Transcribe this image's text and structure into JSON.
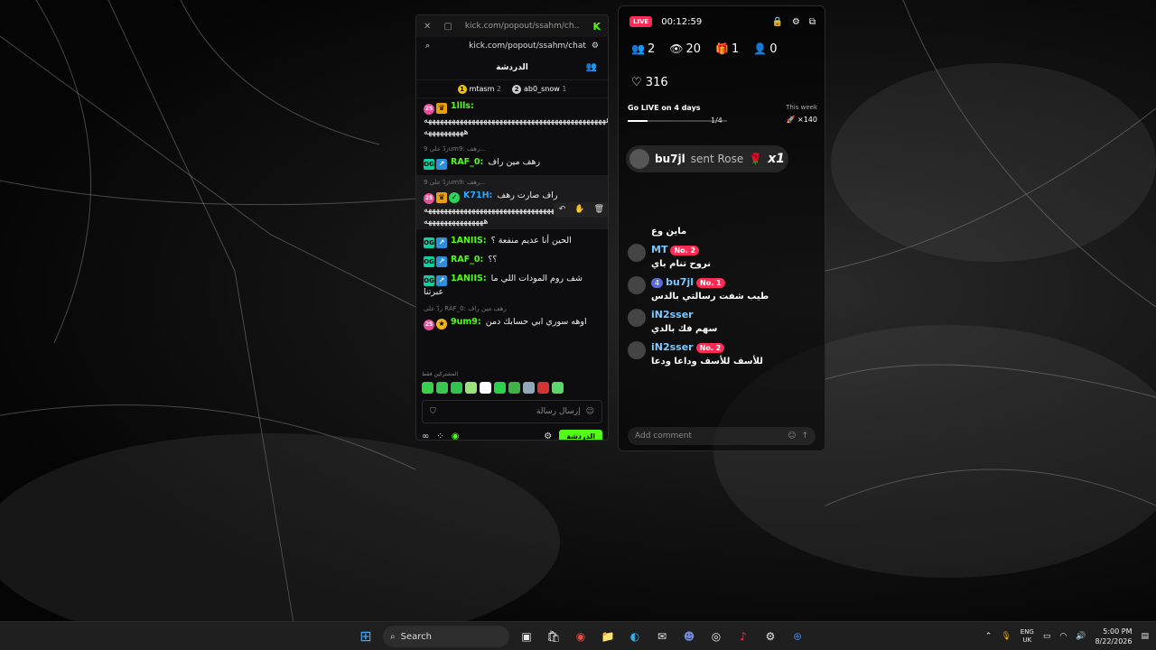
{
  "kick": {
    "window_url_title": "kick.com/popout/ssahm/ch...",
    "address": "kick.com/popout/ssahm/chat",
    "header_title": "الدردشة",
    "pinned": [
      {
        "badge": "1",
        "name": "mtasm",
        "count": "2"
      },
      {
        "badge": "2",
        "name": "ab0_snow",
        "count": "1"
      }
    ],
    "messages": [
      {
        "reply": "",
        "badges": [
          "pink-badge",
          "crown-badge"
        ],
        "user": "1llls:",
        "user_color": "#53fc18",
        "text": "ههههههههههههههههههههههههههههههههههههههههههههههه ههههههههههه"
      },
      {
        "reply": "ردّ على 9um9: رهف...",
        "badges": [
          "og-badge",
          "vip-badge"
        ],
        "user": "RAF_0:",
        "user_color": "#53fc18",
        "text": "رهف مين راف"
      },
      {
        "reply": "ردّ على 9um9: رهف...",
        "badges": [
          "pink-badge",
          "crown-badge",
          "verified-badge"
        ],
        "user": "K71H:",
        "user_color": "#2ea8ff",
        "text": "راف صارت رهف ههههههههههههههههههههههههههههههههههههههههههههههه هههههههههههههههه"
      },
      {
        "reply": "",
        "badges": [
          "og-badge",
          "vip-badge"
        ],
        "user": "1ANIIS:",
        "user_color": "#53fc18",
        "text": "الحين أنا عديم منفعة ؟"
      },
      {
        "reply": "",
        "badges": [
          "og-badge",
          "vip-badge"
        ],
        "user": "RAF_0:",
        "user_color": "#53fc18",
        "text": "؟؟"
      },
      {
        "reply": "",
        "badges": [
          "og-badge",
          "vip-badge"
        ],
        "user": "1ANIIS:",
        "user_color": "#53fc18",
        "text": "شف روم المودات اللي ما عبرتنا"
      },
      {
        "reply": "ردّ على RAF_0: رهف مين راف",
        "badges": [
          "pink-badge",
          "gift-badge"
        ],
        "user": "9um9:",
        "user_color": "#53fc18",
        "text": "اوهه سوري ابي حسابك دمن"
      }
    ],
    "message_actions": [
      "↶",
      "✋",
      "🗑"
    ],
    "emote_label": "المشتركين فقط",
    "emotes": [
      "#3ad14a",
      "#39c651",
      "#2fc24c",
      "#9be27a",
      "#ffffff",
      "#2dd14a",
      "#3fb246",
      "#8fa9b8",
      "#d33535",
      "#5bd66a"
    ],
    "input_placeholder": "إرسال رسالة",
    "chat_button": "الدردشة"
  },
  "live": {
    "badge": "LIVE",
    "timer": "00:12:59",
    "stats": [
      {
        "icon": "users-icon",
        "glyph": "👥",
        "value": "2"
      },
      {
        "icon": "eye-icon",
        "glyph": "👁",
        "value": "20"
      },
      {
        "icon": "gift-icon",
        "glyph": "🎁",
        "value": "1"
      },
      {
        "icon": "add-user-icon",
        "glyph": "👤",
        "value": "0"
      }
    ],
    "likes": "316",
    "goal_title": "Go LIVE on 4 days",
    "goal_week": "This week",
    "goal_fraction": "1/4",
    "goal_progress": 0.2,
    "goal_points": "×140",
    "gift": {
      "user": "bu7jl",
      "sent": "sent Rose",
      "emoji": "🌹",
      "count": "x1"
    },
    "comments": [
      {
        "name": "",
        "level": "",
        "rank": "",
        "text": "ماين وع"
      },
      {
        "name": "MT",
        "level": "",
        "rank": "No. 2",
        "text": "نروح تنام باي"
      },
      {
        "name": "bu7jl",
        "level": "4",
        "rank": "No. 1",
        "text": "طيب شفت رسالتي بالدس"
      },
      {
        "name": "iN2sser",
        "level": "",
        "rank": "",
        "text": "سهم فك بالدي"
      },
      {
        "name": "iN2sser",
        "level": "",
        "rank": "No. 2",
        "text": "للأسف للأسف وداعا ودعا"
      }
    ],
    "add_comment_placeholder": "Add comment"
  },
  "taskbar": {
    "search_label": "Search",
    "lang_top": "ENG",
    "lang_bottom": "UK",
    "time": "5:00 PM",
    "date": "8/22/2026"
  }
}
